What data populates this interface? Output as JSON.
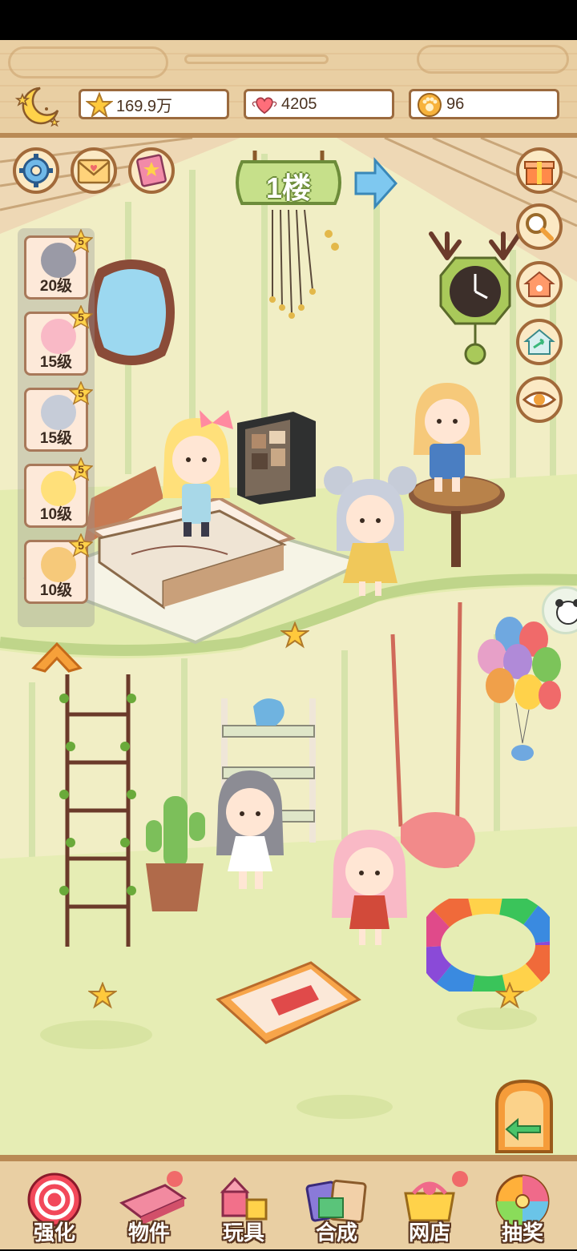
{
  "resources": {
    "stars": "169.9万",
    "hearts": "4205",
    "coins": "96"
  },
  "floor": {
    "label": "1楼"
  },
  "characters": [
    {
      "level": "20级",
      "stars": "5"
    },
    {
      "level": "15级",
      "stars": "5"
    },
    {
      "level": "15级",
      "stars": "5"
    },
    {
      "level": "10级",
      "stars": "5"
    },
    {
      "level": "10级",
      "stars": "5"
    }
  ],
  "bottom_nav": [
    {
      "label": "强化",
      "icon": "lollipop-icon"
    },
    {
      "label": "物件",
      "icon": "piano-icon"
    },
    {
      "label": "玩具",
      "icon": "toy-blocks-icon"
    },
    {
      "label": "合成",
      "icon": "cards-icon"
    },
    {
      "label": "网店",
      "icon": "shop-basket-icon"
    },
    {
      "label": "抽奖",
      "icon": "prize-wheel-icon"
    }
  ],
  "colors": {
    "wood": "#e9cfa3",
    "wood_dark": "#b98a55",
    "floor_green": "#e4ecb0",
    "wall": "#f1eec5"
  }
}
